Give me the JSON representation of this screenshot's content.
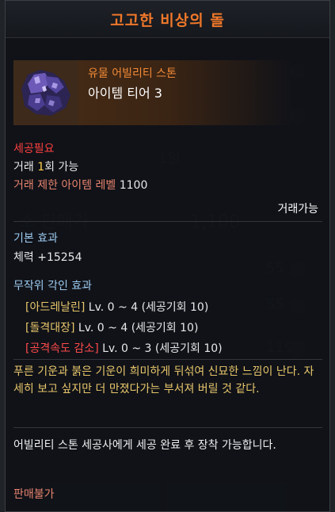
{
  "tooltip": {
    "title": "고고한 비상의 돌",
    "grade": "유물 어빌리티 스톤",
    "tier": "아이템 티어 3",
    "icon": "ability-stone-icon",
    "requirement_title": "세공필요",
    "trade_count_prefix": "거래 ",
    "trade_count_value": "1",
    "trade_count_suffix": "회 가능",
    "trade_level_label": "거래 제한 아이템 레벨",
    "trade_level_value": "1100",
    "tradable": "거래가능",
    "basic_effect_title": "기본 효과",
    "basic_effect": "체력 +15254",
    "random_effect_title": "무작위 각인 효과",
    "engravings": [
      {
        "name": "[아드레날린]",
        "range": "Lv. 0 ~ 4 (세공기회 10)",
        "negative": false
      },
      {
        "name": "[돌격대장]",
        "range": "Lv. 0 ~ 4 (세공기회 10)",
        "negative": false
      },
      {
        "name": "[공격속도 감소]",
        "range": "Lv. 0 ~ 3 (세공기회 10)",
        "negative": true
      }
    ],
    "flavor_text": "푸른 기운과 붉은 기운이 희미하게 뒤섞여 신묘한 느낌이 난다. 자세히 보고 싶지만 더 만졌다가는 부서져 버릴 것 같다.",
    "usage_text": "어빌리티 스톤 세공사에게 세공 완료 후 장착 가능합니다.",
    "sell": "판매불가"
  },
  "colors": {
    "title": "#f0782a",
    "grade": "#f28a36",
    "requirement": "#ff4040",
    "negative": "#ff4a4a",
    "section": "#9ecbf0",
    "flavor": "#e8c66a"
  }
}
